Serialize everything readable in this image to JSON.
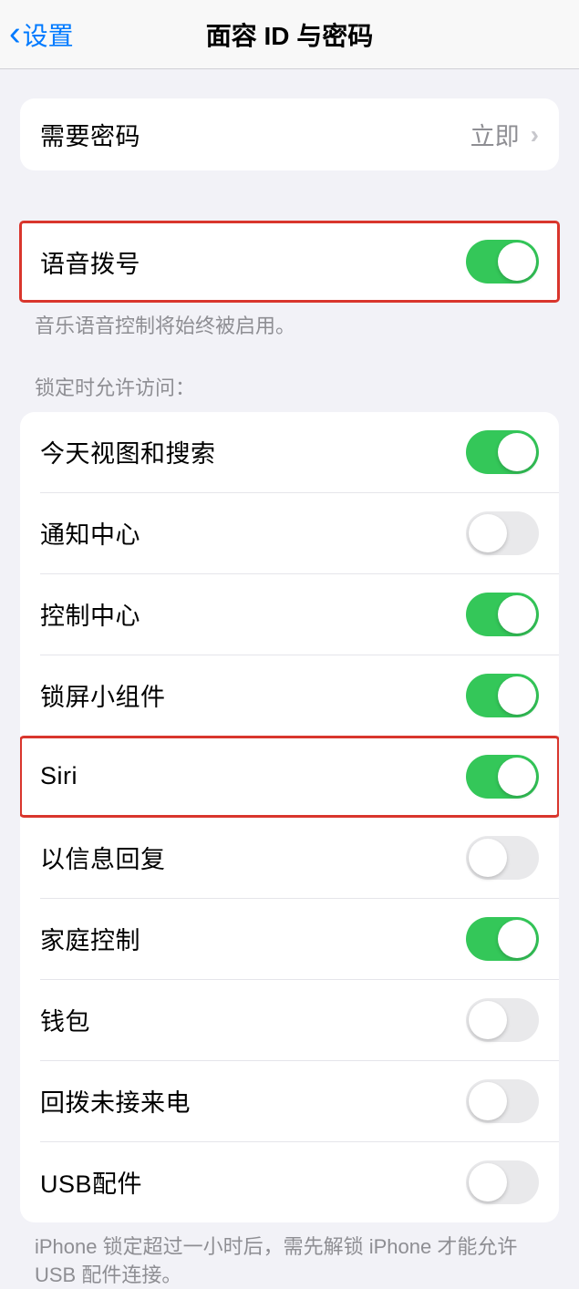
{
  "nav": {
    "back_label": "设置",
    "title": "面容 ID 与密码"
  },
  "passcode_section": {
    "require_passcode_label": "需要密码",
    "require_passcode_value": "立即"
  },
  "voice_dial": {
    "label": "语音拨号",
    "enabled": true,
    "footer": "音乐语音控制将始终被启用。"
  },
  "lock_access": {
    "header": "锁定时允许访问：",
    "items": [
      {
        "label": "今天视图和搜索",
        "enabled": true
      },
      {
        "label": "通知中心",
        "enabled": false
      },
      {
        "label": "控制中心",
        "enabled": true
      },
      {
        "label": "锁屏小组件",
        "enabled": true
      },
      {
        "label": "Siri",
        "enabled": true
      },
      {
        "label": "以信息回复",
        "enabled": false
      },
      {
        "label": "家庭控制",
        "enabled": true
      },
      {
        "label": "钱包",
        "enabled": false
      },
      {
        "label": "回拨未接来电",
        "enabled": false
      },
      {
        "label": "USB配件",
        "enabled": false
      }
    ],
    "footer": "iPhone 锁定超过一小时后，需先解锁 iPhone 才能允许 USB 配件连接。"
  }
}
